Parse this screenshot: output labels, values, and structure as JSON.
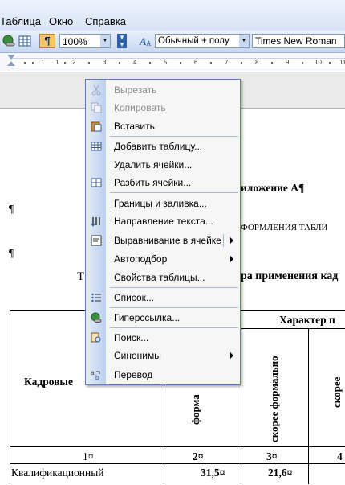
{
  "menubar": {
    "items": [
      "Таблица",
      "Окно",
      "Справка"
    ]
  },
  "toolbar": {
    "zoom": "100%",
    "style": "Обычный + полу",
    "font": "Times New Roman",
    "icons": [
      "hyperlink-icon",
      "table-icon",
      "pilcrow-icon",
      "zoom-dropdown",
      "styles-icon"
    ]
  },
  "ruler": {
    "numbers": [
      "1",
      "1",
      "2",
      "3",
      "4",
      "5",
      "6",
      "7",
      "8",
      "9",
      "10",
      "11"
    ]
  },
  "document": {
    "appendix_title": "иложение А¶",
    "para1": "¶",
    "para2": "¶",
    "heading": "ФОРМЛЕНИЯ ТАБЛИ",
    "subheading_left": "Т",
    "subheading_right": "ра применения кад",
    "col_header_character": "Характер п",
    "row_header": "Кадровые ",
    "vert1": "форма",
    "vert2": "скорее формально",
    "vert3": "скорее",
    "num_row": [
      "1¤",
      "2¤",
      "3¤",
      "4"
    ],
    "data_row_label": "Квалификационный",
    "data_row_values": [
      "31,5¤",
      "21,6¤"
    ]
  },
  "context_menu": {
    "items": [
      {
        "label": "Вырезать",
        "disabled": true,
        "icon": "scissors-icon"
      },
      {
        "label": "Копировать",
        "disabled": true,
        "icon": "copy-icon"
      },
      {
        "label": "Вставить",
        "disabled": false,
        "icon": "paste-icon"
      },
      {
        "label": "Добавить таблицу...",
        "disabled": false,
        "icon": "insert-table-icon"
      },
      {
        "label": "Удалить ячейки...",
        "disabled": false,
        "icon": ""
      },
      {
        "label": "Разбить ячейки...",
        "disabled": false,
        "icon": "split-cells-icon"
      },
      {
        "label": "Границы и заливка...",
        "disabled": false,
        "icon": ""
      },
      {
        "label": "Направление текста...",
        "disabled": false,
        "icon": "text-direction-icon"
      },
      {
        "label": "Выравнивание в ячейке",
        "disabled": false,
        "icon": "cell-align-icon",
        "submenu": true
      },
      {
        "label": "Автоподбор",
        "disabled": false,
        "icon": "",
        "submenu": true
      },
      {
        "label": "Свойства таблицы...",
        "disabled": false,
        "icon": ""
      },
      {
        "label": "Список...",
        "disabled": false,
        "icon": "list-icon"
      },
      {
        "label": "Гиперссылка...",
        "disabled": false,
        "icon": "hyperlink-icon"
      },
      {
        "label": "Поиск...",
        "disabled": false,
        "icon": "research-icon"
      },
      {
        "label": "Синонимы",
        "disabled": false,
        "icon": "",
        "submenu": true
      },
      {
        "label": "Перевод",
        "disabled": false,
        "icon": "translate-icon"
      }
    ]
  }
}
